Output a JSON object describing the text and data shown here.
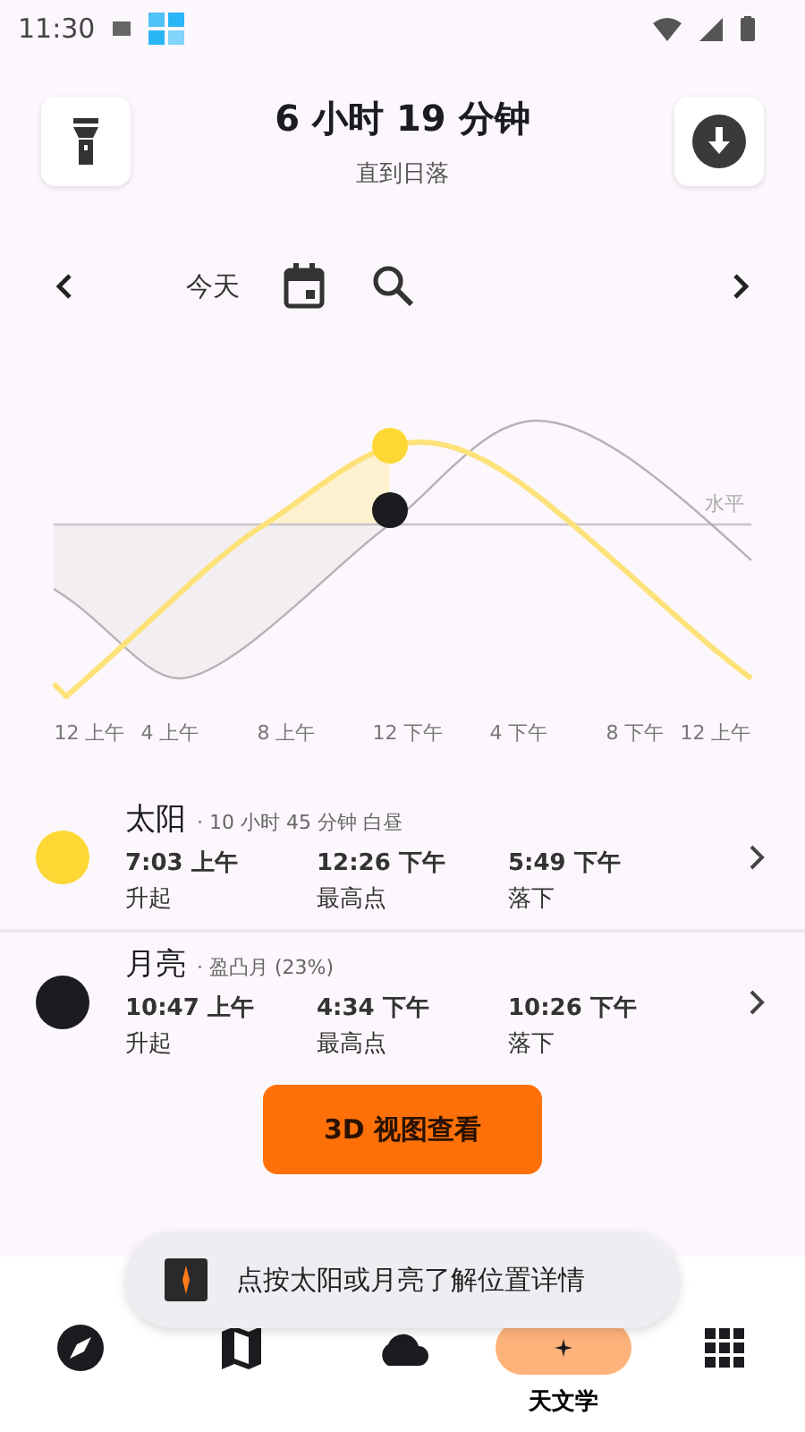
{
  "status_bar": {
    "time": "11:30"
  },
  "header": {
    "title": "6 小时 19 分钟",
    "subtitle": "直到日落"
  },
  "date_nav": {
    "label": "今天"
  },
  "chart": {
    "horizon_label": "水平",
    "time_labels": [
      "12 上午",
      "4 上午",
      "8 上午",
      "12 下午",
      "4 下午",
      "8 下午",
      "12 上午"
    ]
  },
  "bodies": [
    {
      "name": "太阳",
      "detail": "· 10 小时 45 分钟 白昼",
      "color": "#fdd835",
      "events": [
        {
          "time": "7:03 上午",
          "label": "升起"
        },
        {
          "time": "12:26 下午",
          "label": "最高点"
        },
        {
          "time": "5:49 下午",
          "label": "落下"
        }
      ]
    },
    {
      "name": "月亮",
      "detail": "· 盈凸月 (23%)",
      "color": "#1c1b1f",
      "events": [
        {
          "time": "10:47 上午",
          "label": "升起"
        },
        {
          "time": "4:34 下午",
          "label": "最高点"
        },
        {
          "time": "10:26 下午",
          "label": "落下"
        }
      ]
    }
  ],
  "view_3d_button": "3D 视图查看",
  "toast": "点按太阳或月亮了解位置详情",
  "bottom_nav": [
    {
      "kind": "compass",
      "selected": false
    },
    {
      "kind": "map",
      "selected": false
    },
    {
      "kind": "cloud",
      "selected": false
    },
    {
      "kind": "astronomy",
      "label": "天文学",
      "selected": true
    },
    {
      "kind": "apps",
      "selected": false
    }
  ]
}
